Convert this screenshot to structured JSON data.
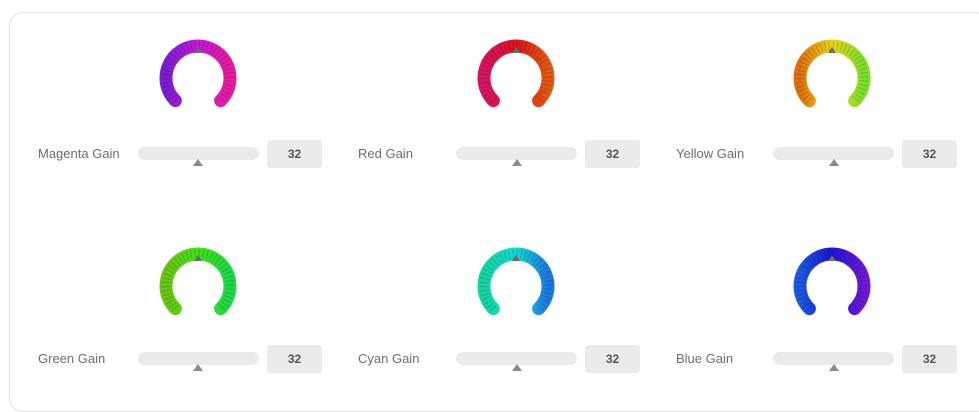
{
  "controls": [
    {
      "label": "Magenta Gain",
      "value": "32",
      "gain": 32,
      "icon": "magenta-ring-icon",
      "colors": [
        "#7a1fd0",
        "#c21ad8",
        "#e81b9c"
      ]
    },
    {
      "label": "Red Gain",
      "value": "32",
      "gain": 32,
      "icon": "red-ring-icon",
      "colors": [
        "#d61464",
        "#d8141c",
        "#e05a12"
      ]
    },
    {
      "label": "Yellow Gain",
      "value": "32",
      "gain": 32,
      "icon": "yellow-ring-icon",
      "colors": [
        "#e0700c",
        "#e8d418",
        "#7ae02a"
      ]
    },
    {
      "label": "Green Gain",
      "value": "32",
      "gain": 32,
      "icon": "green-ring-icon",
      "colors": [
        "#6cc414",
        "#40e018",
        "#1ed84a"
      ]
    },
    {
      "label": "Cyan Gain",
      "value": "32",
      "gain": 32,
      "icon": "cyan-ring-icon",
      "colors": [
        "#14d6a0",
        "#18d8d0",
        "#1a78e0"
      ]
    },
    {
      "label": "Blue Gain",
      "value": "32",
      "gain": 32,
      "icon": "blue-ring-icon",
      "colors": [
        "#1e58e0",
        "#1a14d6",
        "#7018d4"
      ]
    }
  ]
}
